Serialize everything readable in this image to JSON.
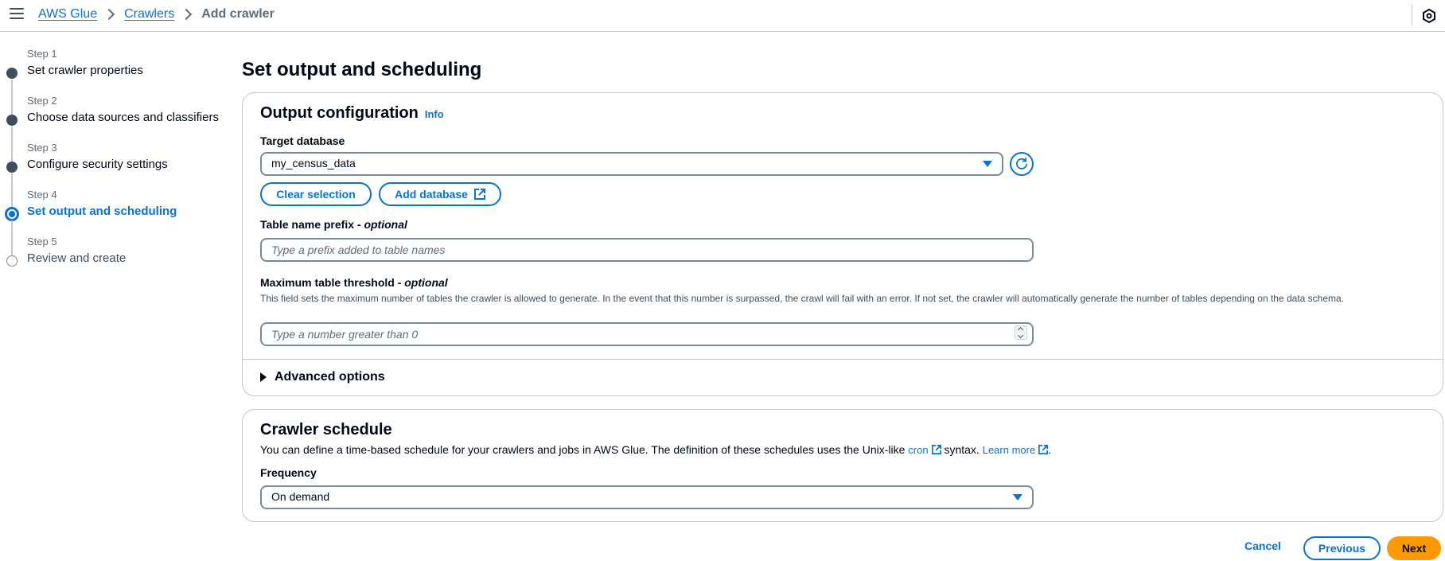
{
  "breadcrumb": {
    "items": [
      "AWS Glue",
      "Crawlers"
    ],
    "current": "Add crawler"
  },
  "steps": [
    {
      "label": "Step 1",
      "title": "Set crawler properties"
    },
    {
      "label": "Step 2",
      "title": "Choose data sources and classifiers"
    },
    {
      "label": "Step 3",
      "title": "Configure security settings"
    },
    {
      "label": "Step 4",
      "title": "Set output and scheduling"
    },
    {
      "label": "Step 5",
      "title": "Review and create"
    }
  ],
  "page": {
    "title": "Set output and scheduling"
  },
  "output": {
    "heading": "Output configuration",
    "info": "Info",
    "target_db_label": "Target database",
    "target_db_value": "my_census_data",
    "clear_selection": "Clear selection",
    "add_database": "Add database",
    "prefix_label": "Table name prefix - ",
    "optional": "optional",
    "prefix_placeholder": "Type a prefix added to table names",
    "threshold_label": "Maximum table threshold - ",
    "threshold_desc": "This field sets the maximum number of tables the crawler is allowed to generate. In the event that this number is surpassed, the crawl will fail with an error. If not set, the crawler will automatically generate the number of tables depending on the data schema.",
    "threshold_placeholder": "Type a number greater than 0",
    "advanced": "Advanced options"
  },
  "schedule": {
    "heading": "Crawler schedule",
    "desc_pre": "You can define a time-based schedule for your crawlers and jobs in AWS Glue. The definition of these schedules uses the Unix-like ",
    "cron": "cron",
    "desc_mid": " syntax. ",
    "learn_more": "Learn more",
    "desc_end": ".",
    "frequency_label": "Frequency",
    "frequency_value": "On demand"
  },
  "footer": {
    "cancel": "Cancel",
    "previous": "Previous",
    "next": "Next"
  },
  "colors": {
    "accent": "#0972d3",
    "primary_button": "#ff9900",
    "text": "#000716"
  }
}
